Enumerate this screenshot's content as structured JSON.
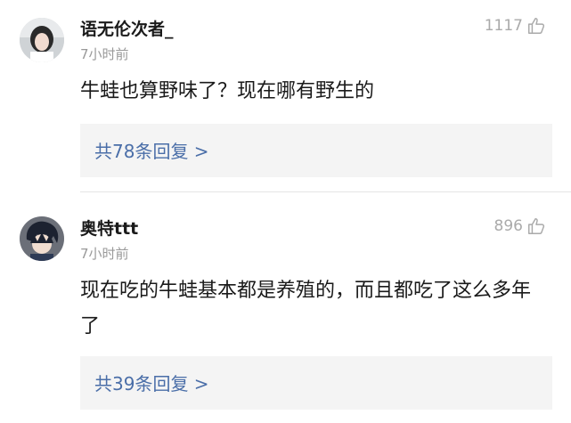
{
  "comments": [
    {
      "username": "语无伦次者_",
      "time": "7小时前",
      "likes": "1117",
      "content": "牛蛙也算野味了？现在哪有野生的",
      "replies": "共78条回复 >"
    },
    {
      "username": "奥特ttt",
      "time": "7小时前",
      "likes": "896",
      "content": "现在吃的牛蛙基本都是养殖的，而且都吃了这么多年了",
      "replies": "共39条回复 >"
    }
  ],
  "colors": {
    "reply_link": "#4a6ea8",
    "reply_bg": "#f4f4f4",
    "meta_text": "#999999",
    "like_icon": "#aaaaaa"
  },
  "icons": [
    "thumbs-up-icon",
    "avatar"
  ]
}
